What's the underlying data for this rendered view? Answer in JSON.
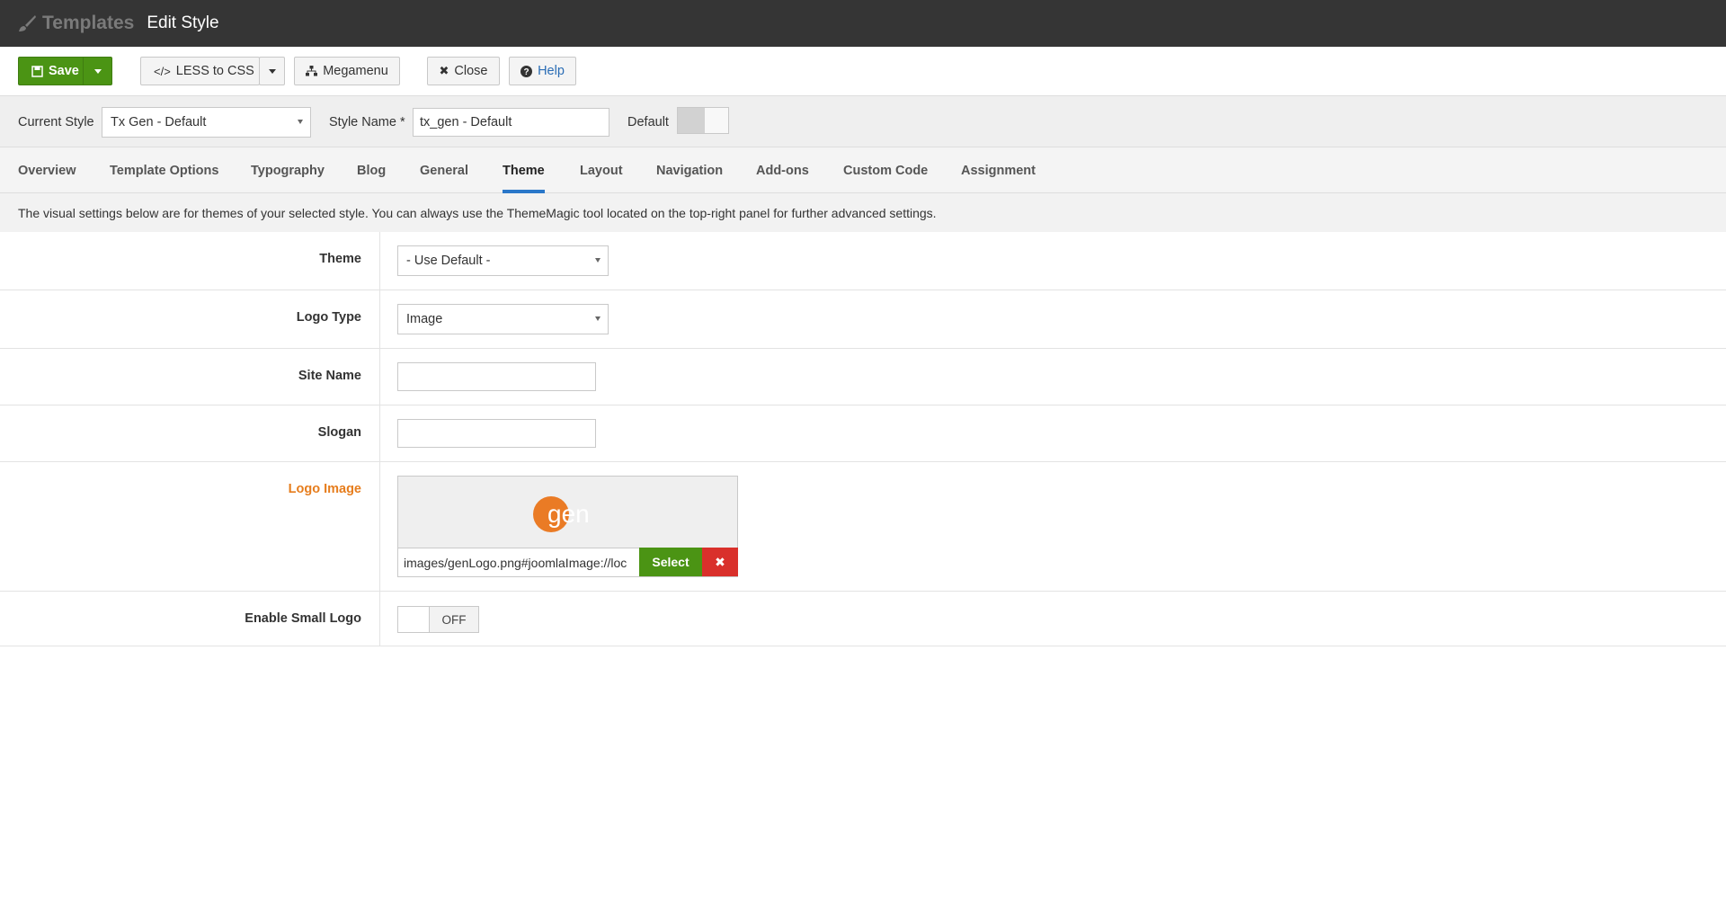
{
  "topbar": {
    "brand": "Templates",
    "title": "Edit Style"
  },
  "toolbar": {
    "save": "Save",
    "less_to_css": "LESS to CSS",
    "megamenu": "Megamenu",
    "close": "Close",
    "help": "Help"
  },
  "style_row": {
    "current_style_label": "Current Style",
    "current_style_value": "Tx Gen - Default",
    "style_name_label": "Style Name *",
    "style_name_value": "tx_gen - Default",
    "default_label": "Default"
  },
  "tabs": [
    "Overview",
    "Template Options",
    "Typography",
    "Blog",
    "General",
    "Theme",
    "Layout",
    "Navigation",
    "Add-ons",
    "Custom Code",
    "Assignment"
  ],
  "active_tab": "Theme",
  "info_text": "The visual settings below are for themes of your selected style. You can always use the ThemeMagic tool located on the top-right panel for further advanced settings.",
  "form": {
    "theme": {
      "label": "Theme",
      "value": "- Use Default -"
    },
    "logo_type": {
      "label": "Logo Type",
      "value": "Image"
    },
    "site_name": {
      "label": "Site Name",
      "value": ""
    },
    "slogan": {
      "label": "Slogan",
      "value": ""
    },
    "logo_image": {
      "label": "Logo Image",
      "path": "images/genLogo.png#joomlaImage://loc",
      "select": "Select",
      "clear": "✖",
      "logo_text": "gen"
    },
    "enable_small_logo": {
      "label": "Enable Small Logo",
      "state": "OFF"
    }
  },
  "colors": {
    "save_green": "#4b9414",
    "clear_red": "#d9302b",
    "accent_blue": "#2a77c9",
    "required_orange": "#e67d1d",
    "logo_orange": "#ea7b25"
  },
  "icons": [
    "paintbrush-icon",
    "floppy-disk-icon",
    "code-icon",
    "sitemap-icon",
    "close-icon",
    "help-icon",
    "times-icon"
  ]
}
